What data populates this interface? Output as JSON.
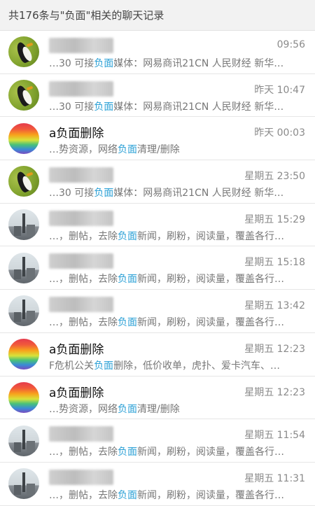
{
  "header": {
    "title": "共176条与\"负面\"相关的聊天记录"
  },
  "colors": {
    "highlight": "#2aa0d6"
  },
  "results": [
    {
      "avatar": "bird-avatar",
      "name": "",
      "time": "09:56",
      "pre": "…30 可接",
      "hl": "负面",
      "post": "媒体：网易商讯21CN 人民财经 新华…"
    },
    {
      "avatar": "bird-avatar",
      "name": "",
      "time": "昨天 10:47",
      "pre": "…30 可接",
      "hl": "负面",
      "post": "媒体：网易商讯21CN 人民财经 新华…"
    },
    {
      "avatar": "rainbow-avatar",
      "name": "a负面删除",
      "time": "昨天 00:03",
      "pre": "…势资源，网络",
      "hl": "负面",
      "post": "清理/删除"
    },
    {
      "avatar": "bird-avatar",
      "name": "",
      "time": "星期五 23:50",
      "pre": "…30 可接",
      "hl": "负面",
      "post": "媒体：网易商讯21CN 人民财经 新华…"
    },
    {
      "avatar": "city-avatar",
      "name": "",
      "time": "星期五 15:29",
      "pre": "…，删帖，去除",
      "hl": "负面",
      "post": "新闻，刷粉，阅读量，覆盖各行…"
    },
    {
      "avatar": "city-avatar",
      "name": "",
      "time": "星期五 15:18",
      "pre": "…，删帖，去除",
      "hl": "负面",
      "post": "新闻，刷粉，阅读量，覆盖各行…"
    },
    {
      "avatar": "city-avatar",
      "name": "",
      "time": "星期五 13:42",
      "pre": "…，删帖，去除",
      "hl": "负面",
      "post": "新闻，刷粉，阅读量，覆盖各行…"
    },
    {
      "avatar": "rainbow-avatar",
      "name": "a负面删除",
      "time": "星期五 12:23",
      "pre": "F危机公关",
      "hl": "负面",
      "post": "删除，低价收单，虎扑、爱卡汽车、…"
    },
    {
      "avatar": "rainbow-avatar",
      "name": "a负面删除",
      "time": "星期五 12:23",
      "pre": "…势资源，网络",
      "hl": "负面",
      "post": "清理/删除"
    },
    {
      "avatar": "city-avatar",
      "name": "",
      "time": "星期五 11:54",
      "pre": "…，删帖，去除",
      "hl": "负面",
      "post": "新闻，刷粉，阅读量，覆盖各行…"
    },
    {
      "avatar": "city-avatar",
      "name": "",
      "time": "星期五 11:31",
      "pre": "…，删帖，去除",
      "hl": "负面",
      "post": "新闻，刷粉，阅读量，覆盖各行…"
    }
  ]
}
